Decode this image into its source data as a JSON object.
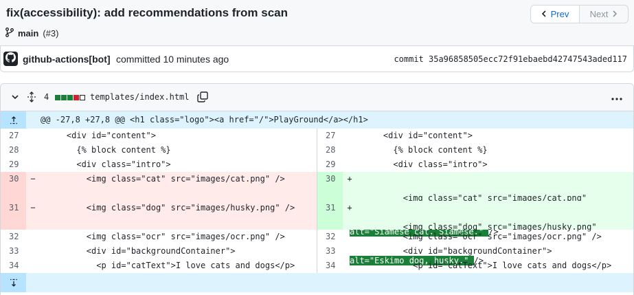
{
  "commit": {
    "title": "fix(accessibility): add recommendations from scan",
    "branch": "main",
    "pr": "(#3)",
    "prev_label": "Prev",
    "next_label": "Next",
    "author": "github-actions[bot]",
    "action": "committed 10 minutes ago",
    "sha_label": "commit 35a96858505ecc72f91ebaebd42747543aded117"
  },
  "file": {
    "changes": "4",
    "path": "templates/index.html",
    "diffstat": [
      "add",
      "add",
      "add",
      "del",
      "neutral"
    ],
    "colors": {
      "add": "#1a7f37",
      "del": "#cf222e",
      "neutral": "#ffffff"
    }
  },
  "diff": {
    "hunk_header": "@@ -27,8 +27,8 @@ <h1 class=\"logo\"><a href=\"/\">PlayGround</a></h1>",
    "left": [
      {
        "num": "27",
        "sign": "",
        "code": "    <div id=\"content\">",
        "type": "ctx"
      },
      {
        "num": "28",
        "sign": "",
        "code": "      {% block content %}",
        "type": "ctx"
      },
      {
        "num": "29",
        "sign": "",
        "code": "      <div class=\"intro\">",
        "type": "ctx"
      },
      {
        "num": "30",
        "sign": "−",
        "code": "        <img class=\"cat\" src=\"images/cat.png\" />",
        "type": "del"
      },
      {
        "num": "31",
        "sign": "−",
        "code": "        <img class=\"dog\" src=\"images/husky.png\" />",
        "type": "del"
      },
      {
        "num": "32",
        "sign": "",
        "code": "        <img class=\"ocr\" src=\"images/ocr.png\" />",
        "type": "ctx"
      },
      {
        "num": "33",
        "sign": "",
        "code": "        <div id=\"backgroundContainer\">",
        "type": "ctx"
      },
      {
        "num": "34",
        "sign": "",
        "code": "          <p id=\"catText\">I love cats and dogs</p>",
        "type": "ctx"
      }
    ],
    "right": [
      {
        "num": "27",
        "sign": "",
        "code": "    <div id=\"content\">",
        "type": "ctx"
      },
      {
        "num": "28",
        "sign": "",
        "code": "      {% block content %}",
        "type": "ctx"
      },
      {
        "num": "29",
        "sign": "",
        "code": "      <div class=\"intro\">",
        "type": "ctx"
      },
      {
        "num": "30",
        "sign": "+",
        "code": "        <img class=\"cat\" src=\"images/cat.png\"",
        "code2_hl": "alt=\"Siamese cat, Siamese.\" ",
        "code2_rest": "/>",
        "type": "add"
      },
      {
        "num": "31",
        "sign": "+",
        "code": "        <img class=\"dog\" src=\"images/husky.png\"",
        "code2_hl": "alt=\"Eskimo dog, husky.\" ",
        "code2_rest": "/>",
        "type": "add"
      },
      {
        "num": "32",
        "sign": "",
        "code": "        <img class=\"ocr\" src=\"images/ocr.png\" />",
        "type": "ctx"
      },
      {
        "num": "33",
        "sign": "",
        "code": "        <div id=\"backgroundContainer\">",
        "type": "ctx"
      },
      {
        "num": "34",
        "sign": "",
        "code": "          <p id=\"catText\">I love cats and dogs</p>",
        "type": "ctx"
      }
    ]
  },
  "icons": {
    "branch": "git-branch-icon",
    "prev": "chevron-left-icon",
    "next": "chevron-right-icon",
    "avatar": "github-mark-icon",
    "collapse": "chevron-down-icon",
    "expand": "unfold-icon",
    "copy": "copy-icon",
    "menu": "kebab-horizontal-icon",
    "expand_up": "fold-up-icon",
    "expand_down": "fold-down-icon"
  }
}
